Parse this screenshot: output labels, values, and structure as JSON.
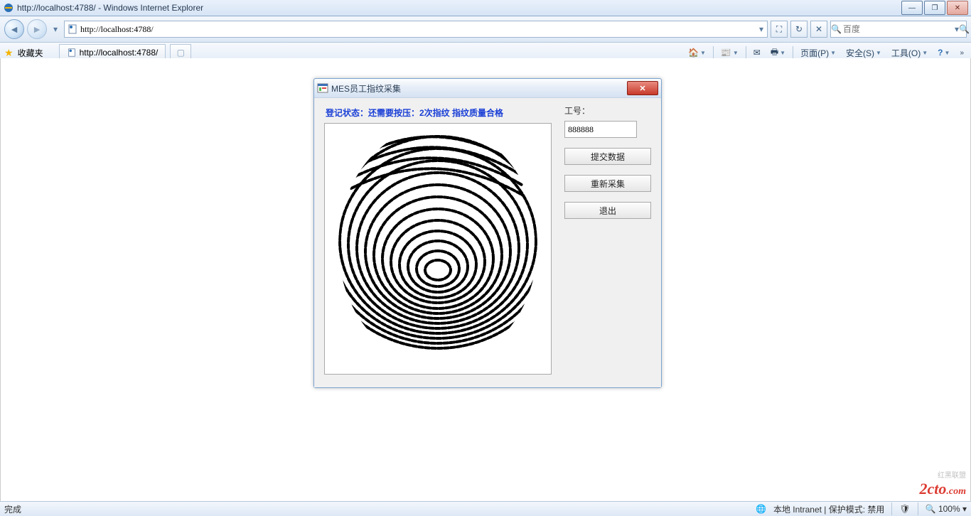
{
  "window": {
    "title": "http://localhost:4788/ - Windows Internet Explorer"
  },
  "window_buttons": {
    "min": "—",
    "max": "❐",
    "close": "✕"
  },
  "nav": {
    "url": "http://localhost:4788/",
    "compat_tip": "⛶",
    "refresh": "↻",
    "stop": "✕",
    "search_placeholder": "百度",
    "search_go": "🔍"
  },
  "cmdbar": {
    "favorites": "收藏夹",
    "tab_title": "http://localhost:4788/",
    "page_menu": "页面(P)",
    "safety_menu": "安全(S)",
    "tools_menu": "工具(O)"
  },
  "dialog": {
    "title": "MES员工指纹采集",
    "status": "登记状态：还需要按压：2次指纹 指纹质量合格",
    "emp_label": "工号：",
    "emp_value": "888888",
    "btn_submit": "提交数据",
    "btn_recap": "重新采集",
    "btn_exit": "退出"
  },
  "status": {
    "done": "完成",
    "zone": "本地 Intranet | 保护模式: 禁用",
    "zoom": "100%"
  },
  "watermark": {
    "brand": "2cto",
    "suffix": ".com",
    "tag": "红黑联盟"
  }
}
